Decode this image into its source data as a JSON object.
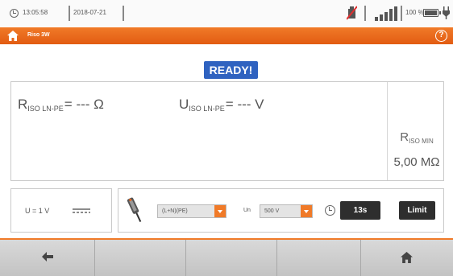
{
  "status_bar": {
    "time": "13:05:58",
    "date": "2018-07-21",
    "battery_percent": "100 %",
    "icons": [
      "clock-icon",
      "usb-disconnected-icon",
      "signal-strength-icon",
      "battery-icon",
      "charging-plug-icon"
    ]
  },
  "title_bar": {
    "title": "Riso 3W",
    "home_icon": "home-icon",
    "help_label": "?"
  },
  "status_badge": "READY!",
  "measurement": {
    "riso": {
      "symbol": "R",
      "subscript": "ISO LN-PE",
      "value": "= --- Ω"
    },
    "uiso": {
      "symbol": "U",
      "subscript": "ISO LN-PE",
      "value": "= --- V"
    },
    "riso_min": {
      "symbol": "R",
      "subscript": "ISO MIN",
      "value": "5,00 MΩ"
    }
  },
  "voltage_display": {
    "text": "U = 1 V",
    "icon": "dc-voltage-icon"
  },
  "settings": {
    "probe_icon": "probe-icon",
    "connection_mode": "(L+N)(PE)",
    "un_label": "Un",
    "un_value": "500 V",
    "timer_icon": "clock-icon",
    "time_button": "13s",
    "limit_button": "Limit"
  },
  "bottom_nav": {
    "buttons": [
      "back-arrow-icon",
      "",
      "",
      "",
      "home-icon"
    ]
  },
  "colors": {
    "accent_orange": "#e8651a",
    "ready_blue": "#2f62c0",
    "dark_button": "#2e2e2e"
  }
}
